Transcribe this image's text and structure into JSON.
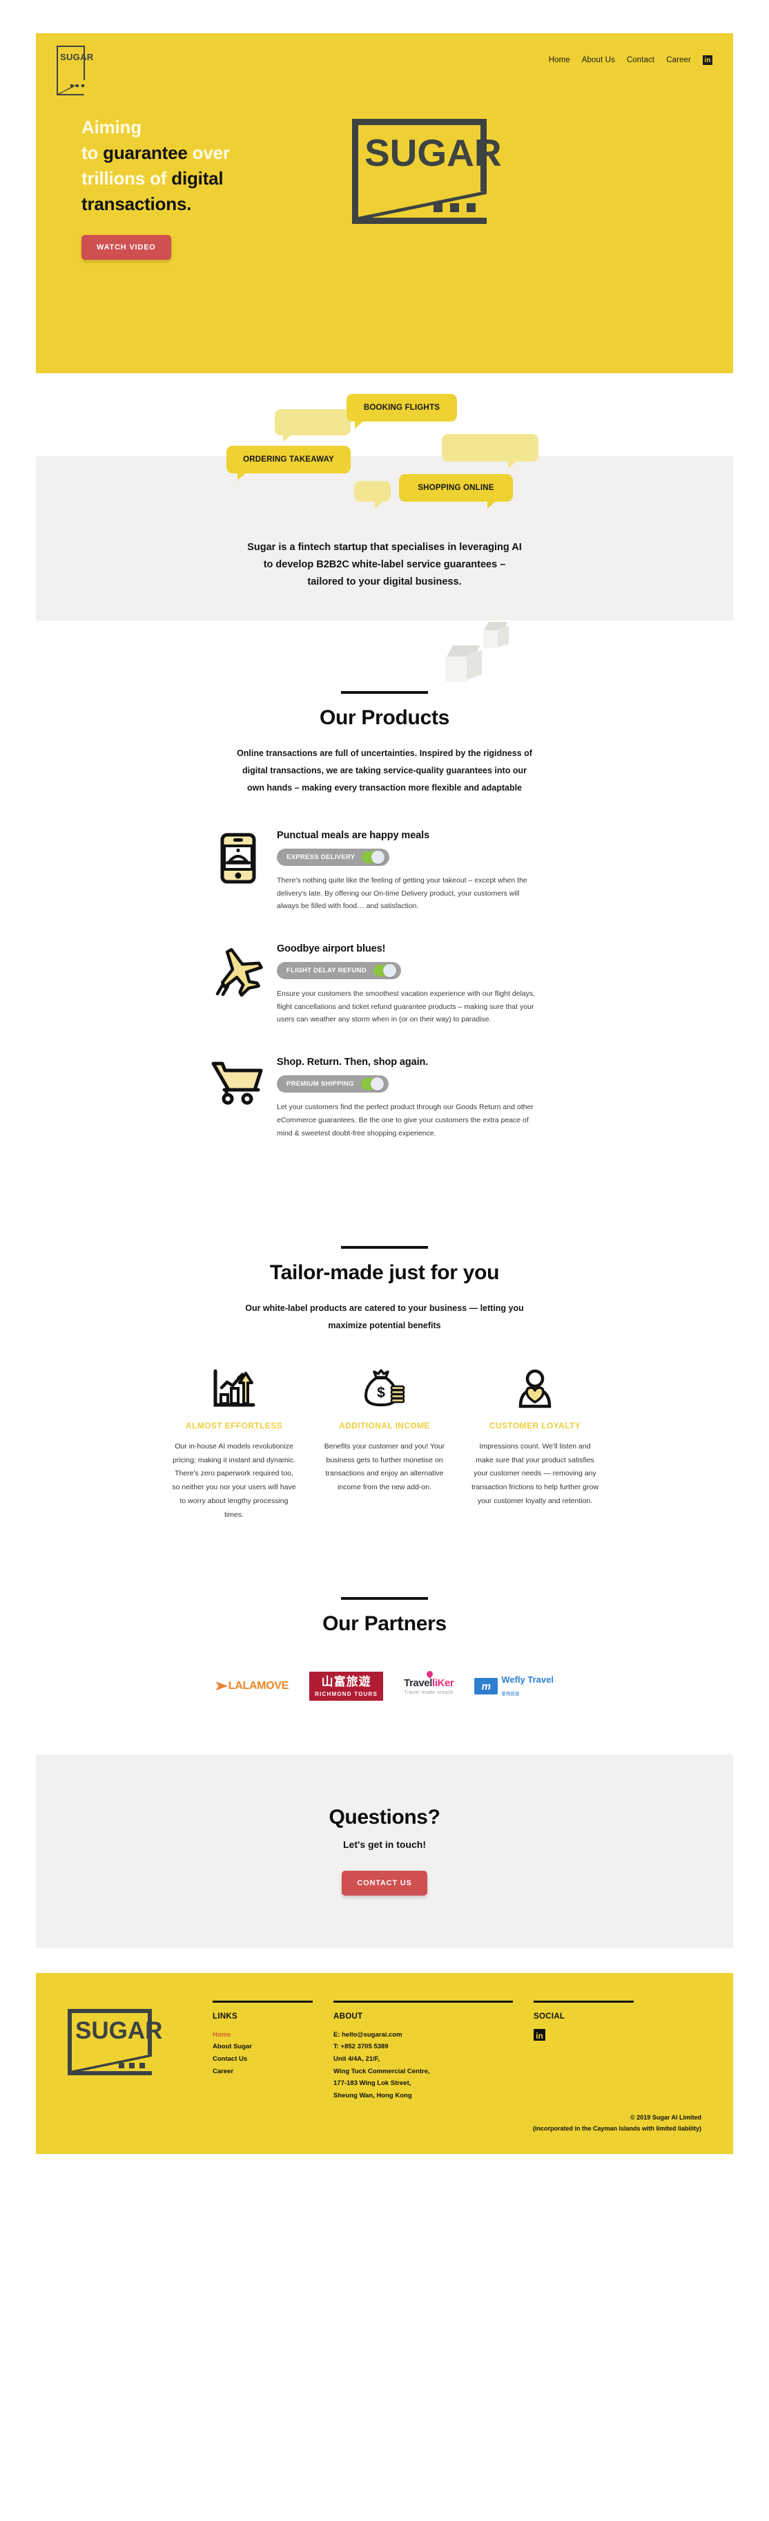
{
  "brand": {
    "name": "SUGAR",
    "logo_dots": "..."
  },
  "nav": {
    "items": [
      {
        "label": "Home"
      },
      {
        "label": "About Us"
      },
      {
        "label": "Contact"
      },
      {
        "label": "Career"
      }
    ],
    "social_icon": "linkedin-icon",
    "social_glyph": "in"
  },
  "hero": {
    "line1_white": "Aiming",
    "line2_white_a": "to ",
    "line2_black": "guarantee",
    "line2_white_b": " over",
    "line3_white": "trillions of ",
    "line3_black": "digital",
    "line4_black": "transactions.",
    "cta": "WATCH VIDEO",
    "bg_color": "#efd034",
    "cta_color": "#cf5050"
  },
  "bubbles": [
    {
      "label": "BOOKING FLIGHTS",
      "style": "strong"
    },
    {
      "label": "ORDERING TAKEAWAY",
      "style": "strong"
    },
    {
      "label": "SHOPPING ONLINE",
      "style": "strong"
    },
    {
      "label": "",
      "style": "faint"
    },
    {
      "label": "",
      "style": "faint"
    },
    {
      "label": "",
      "style": "faint"
    }
  ],
  "intro": {
    "line1": "Sugar is a fintech startup that specialises in leveraging AI",
    "line2": "to develop B2B2C white-label service guarantees –",
    "line3": "tailored to your digital business."
  },
  "products_section": {
    "title": "Our Products",
    "subtitle_line1": "Online transactions are full of uncertainties. Inspired by the rigidness of",
    "subtitle_line2": "digital transactions, we are taking service-quality guarantees into our",
    "subtitle_line3": "own hands – making every transaction more flexible and adaptable",
    "items": [
      {
        "icon": "smartphone-food-icon",
        "title": "Punctual meals are happy meals",
        "pill_label": "EXPRESS DELIVERY",
        "toggle_on": true,
        "description": "There's nothing quite like the feeling of getting your takeout – except when the delivery's late. By offering our On-time Delivery product, your customers will always be filled with food… and satisfaction."
      },
      {
        "icon": "airplane-icon",
        "title": "Goodbye airport blues!",
        "pill_label": "FLIGHT DELAY REFUND",
        "toggle_on": true,
        "description": "Ensure your customers the smoothest vacation experience with our flight delays, flight cancellations and ticket refund guarantee products – making sure that your users can weather any storm when in (or on their way) to paradise."
      },
      {
        "icon": "shopping-cart-icon",
        "title": "Shop. Return. Then, shop again.",
        "pill_label": "PREMIUM SHIPPING",
        "toggle_on": true,
        "description": "Let your customers find the perfect product through our Goods Return and other eCommerce guarantees. Be the one to give your customers the extra peace of mind & sweetest doubt-free shopping experience."
      }
    ]
  },
  "tailor_section": {
    "title": "Tailor-made just for you",
    "subtitle_line1": "Our white-label products are catered to your business — letting you",
    "subtitle_line2": "maximize potential benefits",
    "columns": [
      {
        "icon": "growth-chart-icon",
        "title": "ALMOST EFFORTLESS",
        "text": "Our in-house AI models revolutionize pricing; making it instant and dynamic. There's zero paperwork required too, so neither you nor your users will have to worry about lengthy processing times."
      },
      {
        "icon": "money-bag-icon",
        "title": "ADDITIONAL INCOME",
        "text": "Benefits your customer and you! Your business gets to further monetise on transactions and enjoy an alternative income from the new add-on."
      },
      {
        "icon": "customer-heart-icon",
        "title": "CUSTOMER LOYALTY",
        "text": "Impressions count. We'll listen and make sure that your product satisfies your customer needs — removing any transaction frictions to help further grow your customer loyalty and retention."
      }
    ],
    "accent_color": "#eccf3e"
  },
  "partners_section": {
    "title": "Our Partners",
    "logos": [
      {
        "name": "lalamove-logo",
        "text": "LALAMOVE"
      },
      {
        "name": "richmond-tours-logo",
        "text_cn": "山富旅遊",
        "text_en": "RICHMOND TOURS"
      },
      {
        "name": "travelliker-logo",
        "text_a": "Travel",
        "text_b": "liKer",
        "tagline": "Travel made simple"
      },
      {
        "name": "wefly-travel-logo",
        "mark": "m",
        "text_a": "Wefly Travel",
        "text_b": "愛飛旅遊"
      }
    ]
  },
  "questions_section": {
    "title": "Questions?",
    "subtitle": "Let's get in touch!",
    "cta": "CONTACT US"
  },
  "footer": {
    "links_head": "LINKS",
    "links": [
      {
        "label": "Home",
        "active": true
      },
      {
        "label": "About Sugar",
        "active": false
      },
      {
        "label": "Contact Us",
        "active": false
      },
      {
        "label": "Career",
        "active": false
      }
    ],
    "about_head": "ABOUT",
    "about_lines": [
      "E: hello@sugarai.com",
      "T: +852 3705 5389",
      "Unit 4/4A, 21/F,",
      "Wing Tuck Commercial Centre,",
      "177-183 Wing Lok Street,",
      "Sheung Wan, Hong Kong"
    ],
    "social_head": "SOCIAL",
    "social_glyph": "in",
    "copyright_line1": "© 2019 Sugar AI Limited",
    "copyright_line2": "(incorporated in the Cayman Islands with limited liability)"
  }
}
